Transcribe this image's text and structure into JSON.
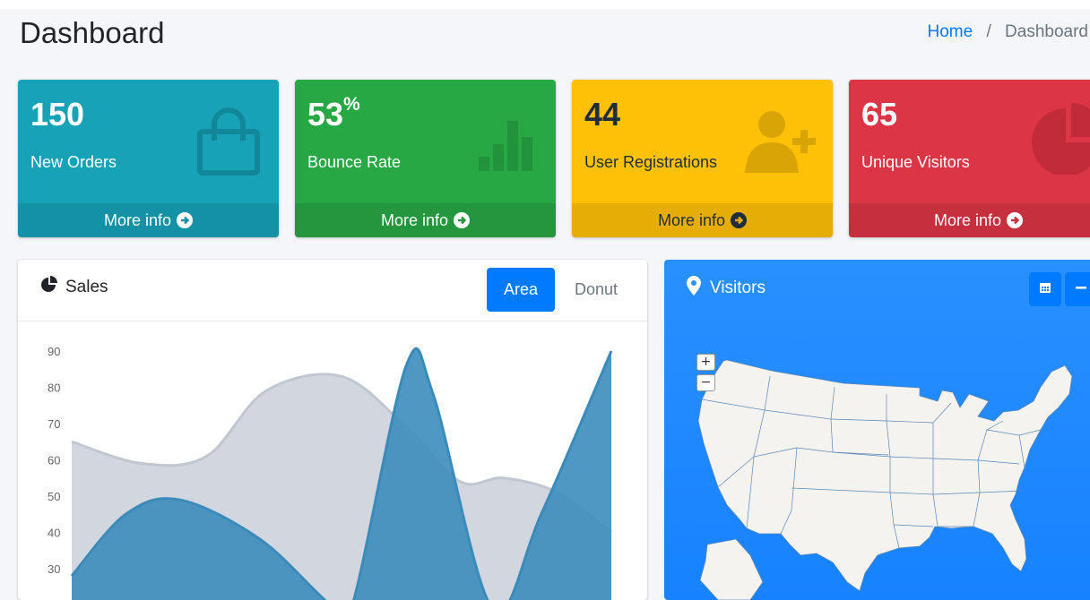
{
  "header": {
    "title": "Dashboard",
    "breadcrumb": {
      "home": "Home",
      "separator": "/",
      "current": "Dashboard"
    }
  },
  "stat_boxes": [
    {
      "value": "150",
      "suffix": "",
      "label": "New Orders",
      "footer": "More info",
      "icon": "shopping-bag-icon",
      "color": "#17a2b8"
    },
    {
      "value": "53",
      "suffix": "%",
      "label": "Bounce Rate",
      "footer": "More info",
      "icon": "bar-chart-icon",
      "color": "#28a745"
    },
    {
      "value": "44",
      "suffix": "",
      "label": "User Registrations",
      "footer": "More info",
      "icon": "user-plus-icon",
      "color": "#ffc107"
    },
    {
      "value": "65",
      "suffix": "",
      "label": "Unique Visitors",
      "footer": "More info",
      "icon": "pie-chart-icon",
      "color": "#dc3545"
    }
  ],
  "sales_card": {
    "title": "Sales",
    "icon": "chart-pie-icon",
    "tabs": [
      {
        "label": "Area",
        "active": true
      },
      {
        "label": "Donut",
        "active": false
      }
    ]
  },
  "visitors_card": {
    "title": "Visitors",
    "icon": "map-marker-icon",
    "tools": [
      "calendar-icon",
      "minus-icon"
    ],
    "zoom": {
      "in": "+",
      "out": "−"
    }
  },
  "chart_data": {
    "type": "area",
    "title": "",
    "xlabel": "",
    "ylabel": "",
    "ylim": [
      25,
      90
    ],
    "yticks": [
      90,
      80,
      70,
      60,
      50,
      40,
      30
    ],
    "grid": false,
    "series": [
      {
        "color": "#d2d6de",
        "points": [
          [
            0,
            65
          ],
          [
            0.13,
            59
          ],
          [
            0.25,
            61
          ],
          [
            0.36,
            79
          ],
          [
            0.5,
            83
          ],
          [
            0.62,
            69
          ],
          [
            0.72,
            54
          ],
          [
            0.8,
            55
          ],
          [
            0.9,
            51
          ],
          [
            1.0,
            40
          ]
        ]
      },
      {
        "color": "#3c8dbc",
        "points": [
          [
            0,
            28
          ],
          [
            0.1,
            45
          ],
          [
            0.2,
            49
          ],
          [
            0.35,
            38
          ],
          [
            0.48,
            20
          ],
          [
            0.52,
            20
          ],
          [
            0.62,
            86
          ],
          [
            0.67,
            78
          ],
          [
            0.78,
            19
          ],
          [
            0.87,
            45
          ],
          [
            1.0,
            90
          ]
        ]
      }
    ]
  }
}
